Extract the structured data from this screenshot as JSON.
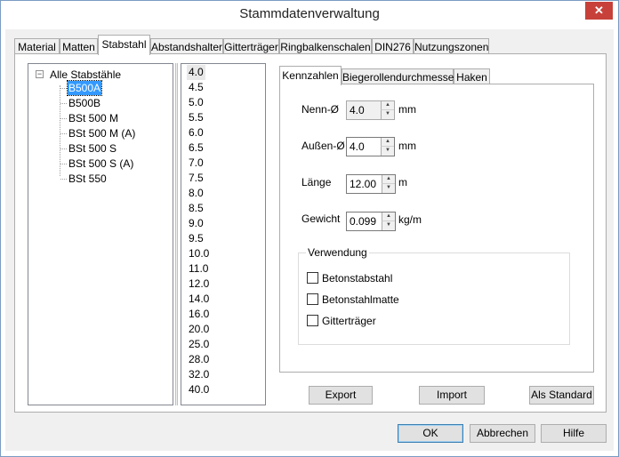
{
  "window": {
    "title": "Stammdatenverwaltung",
    "close_glyph": "✕"
  },
  "tabs": [
    {
      "label": "Material"
    },
    {
      "label": "Matten"
    },
    {
      "label": "Stabstahl"
    },
    {
      "label": "Abstandshalter"
    },
    {
      "label": "Gitterträger"
    },
    {
      "label": "Ringbalkenschalen"
    },
    {
      "label": "DIN276"
    },
    {
      "label": "Nutzungszonen"
    }
  ],
  "active_tab": "Stabstahl",
  "tree": {
    "expander": "−",
    "root": "Alle Stabstähle",
    "items": [
      "B500A",
      "B500B",
      "BSt 500 M",
      "BSt 500 M (A)",
      "BSt 500 S",
      "BSt 500 S (A)",
      "BSt 550"
    ],
    "selected": "B500A"
  },
  "diameters": {
    "items": [
      "4.0",
      "4.5",
      "5.0",
      "5.5",
      "6.0",
      "6.5",
      "7.0",
      "7.5",
      "8.0",
      "8.5",
      "9.0",
      "9.5",
      "10.0",
      "11.0",
      "12.0",
      "14.0",
      "16.0",
      "20.0",
      "25.0",
      "28.0",
      "32.0",
      "40.0"
    ],
    "selected": "4.0"
  },
  "sub_tabs": [
    {
      "label": "Kennzahlen"
    },
    {
      "label": "Biegerollendurchmesser"
    },
    {
      "label": "Haken"
    }
  ],
  "fields": {
    "nenn": {
      "label": "Nenn-Ø",
      "value": "4.0",
      "unit": "mm"
    },
    "aussen": {
      "label": "Außen-Ø",
      "value": "4.0",
      "unit": "mm"
    },
    "laenge": {
      "label": "Länge",
      "value": "12.00",
      "unit": "m"
    },
    "gewicht": {
      "label": "Gewicht",
      "value": "0.099",
      "unit": "kg/m"
    }
  },
  "verwendung": {
    "title": "Verwendung",
    "options": [
      {
        "label": "Betonstabstahl",
        "checked": false
      },
      {
        "label": "Betonstahlmatte",
        "checked": false
      },
      {
        "label": "Gitterträger",
        "checked": false
      }
    ]
  },
  "actions": {
    "export": "Export",
    "import": "Import",
    "standard": "Als Standard"
  },
  "footer": {
    "ok": "OK",
    "cancel": "Abbrechen",
    "help": "Hilfe"
  },
  "colors": {
    "selection": "#3399ff",
    "close": "#c7413a",
    "border": "#adadad"
  }
}
